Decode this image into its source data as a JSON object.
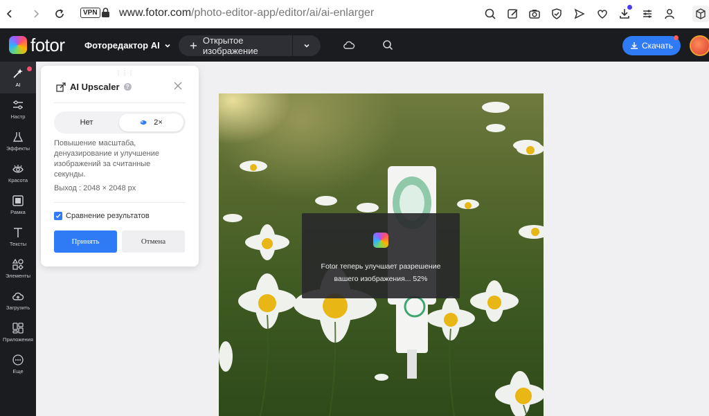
{
  "browser": {
    "vpn": "VPN",
    "url_host": "www.fotor.com",
    "url_path": "/photo-editor-app/editor/ai/ai-enlarger"
  },
  "app": {
    "logo": "fotor",
    "menu_label": "Фоторедактор AI",
    "open_image_label": "Открытое изображение",
    "download_label": "Скачать"
  },
  "sidebar": {
    "items": [
      {
        "label": "AI",
        "icon": "sparkle-icon"
      },
      {
        "label": "Настр",
        "icon": "sliders-icon"
      },
      {
        "label": "Эффекты",
        "icon": "flask-icon"
      },
      {
        "label": "Красота",
        "icon": "eye-icon"
      },
      {
        "label": "Рамка",
        "icon": "frame-icon"
      },
      {
        "label": "Тексты",
        "icon": "text-icon"
      },
      {
        "label": "Элементы",
        "icon": "shapes-icon"
      },
      {
        "label": "Загрузить",
        "icon": "cloud-upload-icon"
      },
      {
        "label": "Приложения",
        "icon": "apps-icon"
      },
      {
        "label": "Еще",
        "icon": "more-icon"
      }
    ]
  },
  "panel": {
    "title": "AI Upscaler",
    "options": [
      "Нет",
      "2×"
    ],
    "selected": "2×",
    "description": "Повышение масштаба, денуазирование и улучшение изображений за считанные секунды.",
    "output": "Выход : 2048 × 2048 px",
    "compare_label": "Сравнение результатов",
    "compare_checked": true,
    "accept_label": "Принять",
    "cancel_label": "Отмена"
  },
  "progress": {
    "line1": "Fotor теперь улучшает разрешение",
    "line2": "вашего изображения... 52%",
    "percent": 52
  },
  "colors": {
    "accent": "#2f7bf5",
    "appbar": "#1b1c20"
  }
}
